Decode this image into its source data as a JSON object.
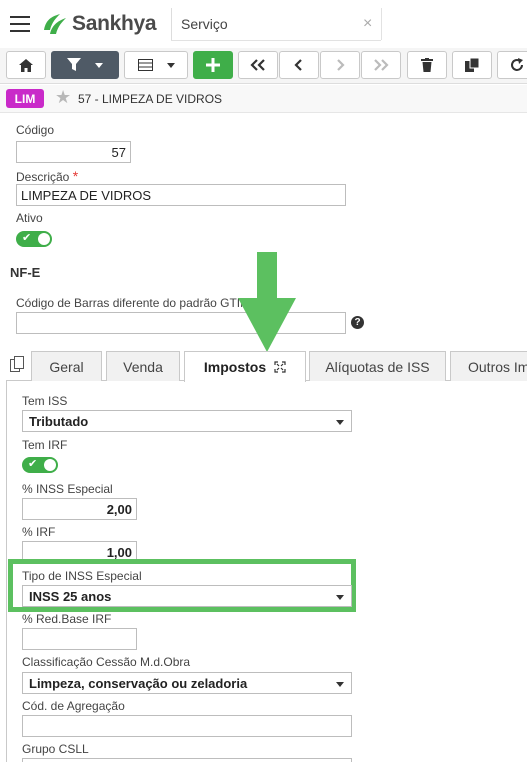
{
  "app": {
    "brand": "Sankhya",
    "tab_title": "Serviço",
    "tab_close": "×"
  },
  "record": {
    "badge": "LIM",
    "title": "57 - LIMPEZA DE VIDROS"
  },
  "form": {
    "codigo_label": "Código",
    "codigo_value": "57",
    "descricao_label": "Descrição",
    "required_mark": "*",
    "descricao_value": "LIMPEZA DE VIDROS",
    "ativo_label": "Ativo",
    "section_nfe": "NF-E",
    "gtin_label": "Código de Barras diferente do padrão GTIN",
    "gtin_value": "",
    "help": "?"
  },
  "tabs": [
    {
      "label": "Geral"
    },
    {
      "label": "Venda"
    },
    {
      "label": "Impostos"
    },
    {
      "label": "Alíquotas de ISS"
    },
    {
      "label": "Outros Im"
    }
  ],
  "impostos": {
    "tem_iss_label": "Tem ISS",
    "tem_iss_value": "Tributado",
    "tem_irf_label": "Tem IRF",
    "inss_especial_label": "% INSS Especial",
    "inss_especial_value": "2,00",
    "irf_label": "% IRF",
    "irf_value": "1,00",
    "tipo_inss_label": "Tipo de INSS Especial",
    "tipo_inss_value": "INSS 25 anos",
    "red_base_irf_label": "% Red.Base IRF",
    "red_base_irf_value": "",
    "classificacao_label": "Classificação Cessão M.d.Obra",
    "classificacao_value": "Limpeza, conservação ou zeladoria",
    "agregacao_label": "Cód. de Agregação",
    "agregacao_value": "",
    "grupo_csll_label": "Grupo CSLL"
  },
  "colors": {
    "accent_green": "#3fae49",
    "badge_magenta": "#c92ac9",
    "highlight_green": "#5cc060"
  }
}
